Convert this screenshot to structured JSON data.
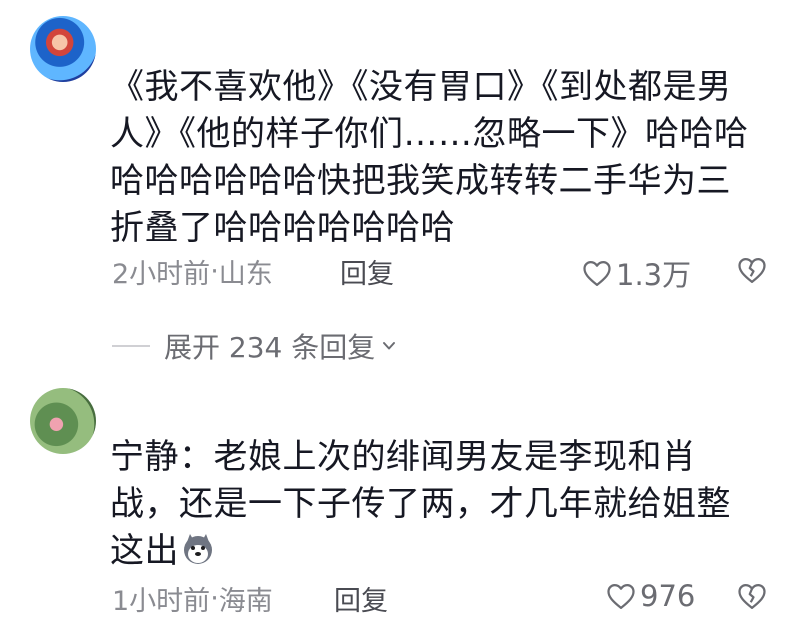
{
  "comments": [
    {
      "text": "《我不喜欢他》《没有胃口》《到处都是男人》《他的样子你们……忽略一下》哈哈哈哈哈哈哈哈哈快把我笑成转转二手华为三折叠了哈哈哈哈哈哈哈",
      "time": "2小时前",
      "separator": "·",
      "location": "山东",
      "reply_label": "回复",
      "likes": "1.3万"
    },
    {
      "text": "宁静：老娘上次的绯闻男友是李现和肖战，还是一下子传了两，才几年就给姐整这出",
      "time": "1小时前",
      "separator": "·",
      "location": "海南",
      "reply_label": "回复",
      "likes": "976"
    }
  ],
  "expand_replies": "展开 234 条回复",
  "icons": {
    "like": "heart-outline-icon",
    "dislike": "broken-heart-icon",
    "expand": "chevron-down-icon",
    "emoji": "husky-emoji-icon"
  },
  "colors": {
    "text": "#161823",
    "meta": "#8a8b91",
    "background": "#ffffff"
  }
}
